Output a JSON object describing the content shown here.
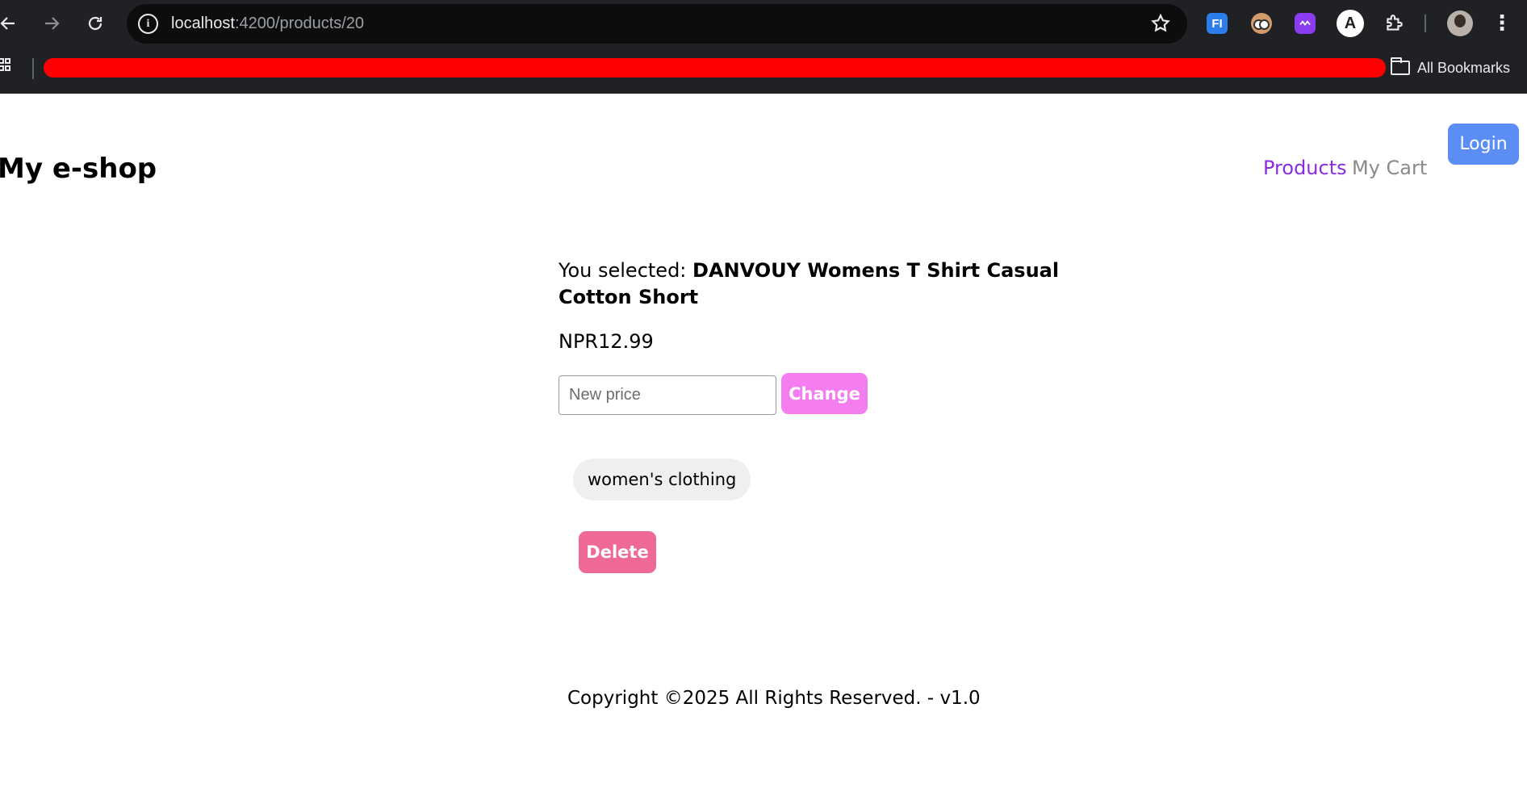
{
  "browser": {
    "url_host": "localhost",
    "url_rest": ":4200/products/20",
    "extensions": {
      "fi_label": "FI",
      "angular_label": "A"
    },
    "bookmarks_label": "All Bookmarks",
    "bookmarks_bar_color": "#ff0000"
  },
  "header": {
    "brand": "My e-shop",
    "nav": {
      "products": "Products",
      "cart": "My Cart"
    },
    "login_label": "Login"
  },
  "product": {
    "selected_prefix": "You selected: ",
    "name": "DANVOUY Womens T Shirt Casual Cotton Short",
    "price": "NPR12.99",
    "new_price_placeholder": "New price",
    "change_label": "Change",
    "category": "women's clothing",
    "delete_label": "Delete"
  },
  "footer": {
    "text": "Copyright ©2025 All Rights Reserved. - v1.0"
  },
  "colors": {
    "accent_nav": "#8a2be2",
    "login": "#5b8df5",
    "change": "#f47ef0",
    "delete": "#ee6a95"
  }
}
